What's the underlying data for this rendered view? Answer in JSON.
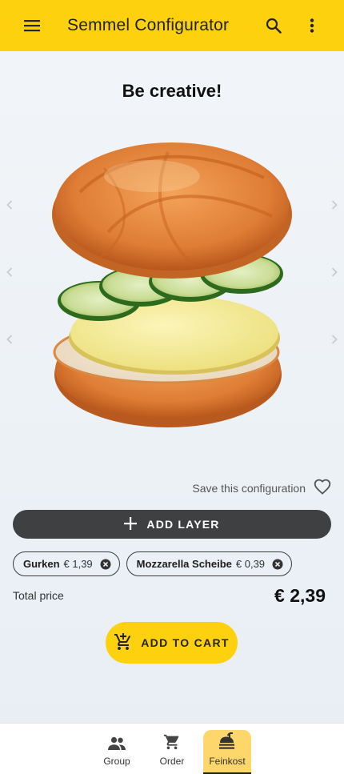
{
  "appbar": {
    "title": "Semmel Configurator",
    "menu_icon": "menu-icon",
    "search_icon": "search-icon",
    "more_icon": "more-vert-icon",
    "color": "#fdd10e"
  },
  "headline": "Be creative!",
  "save": {
    "label": "Save this configuration",
    "icon": "heart-outline-icon"
  },
  "add_layer": {
    "label": "ADD LAYER",
    "icon": "plus-icon"
  },
  "layers": [
    {
      "name": "Gurken",
      "price": "€ 1,39"
    },
    {
      "name": "Mozzarella Scheibe",
      "price": "€ 0,39"
    }
  ],
  "total": {
    "label": "Total price",
    "value": "€ 2,39"
  },
  "add_to_cart": {
    "label": "ADD TO CART",
    "icon": "add-shopping-cart-icon"
  },
  "nav": [
    {
      "label": "Group",
      "icon": "group-icon",
      "active": false
    },
    {
      "label": "Order",
      "icon": "cart-icon",
      "active": false
    },
    {
      "label": "Feinkost",
      "icon": "food-bank-icon",
      "active": true
    }
  ]
}
